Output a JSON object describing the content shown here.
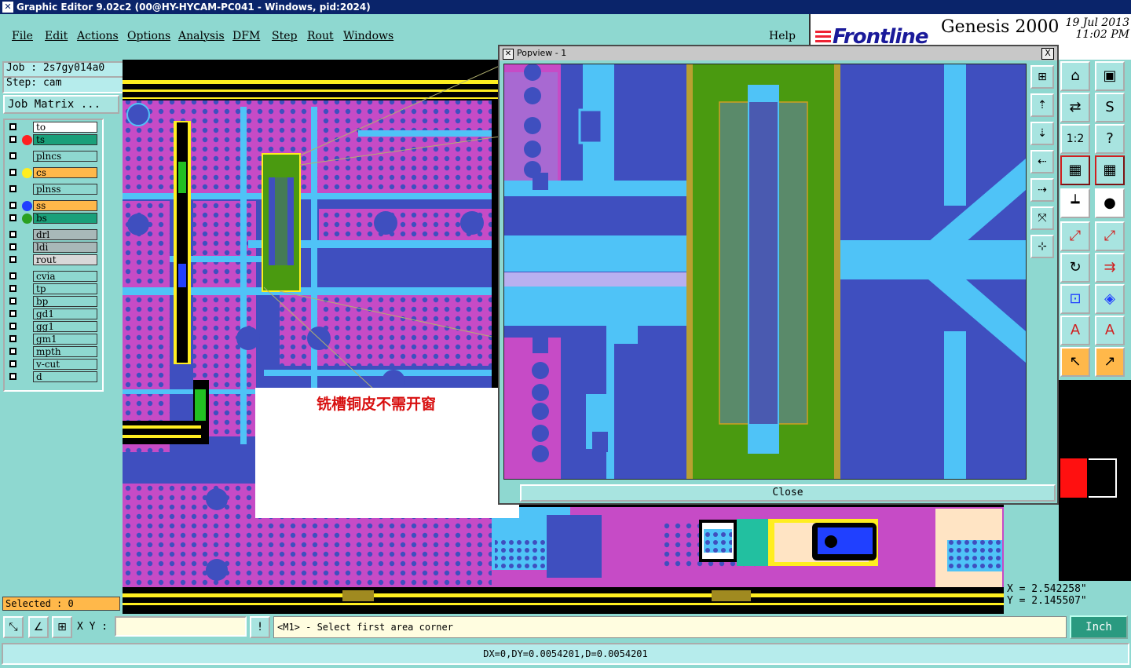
{
  "window": {
    "title": "Graphic Editor 9.02c2 (00@HY-HYCAM-PC041 - Windows, pid:2024)"
  },
  "menu": [
    "File",
    "Edit",
    "Actions",
    "Options",
    "Analysis",
    "DFM",
    "Step",
    "Rout",
    "Windows"
  ],
  "help_label": "Help",
  "brand": {
    "logo": "Frontline",
    "product": "Genesis 2000",
    "date": "19 Jul 2013",
    "time": "11:02 PM"
  },
  "job": {
    "name": "Job : 2s7gy014a0",
    "step": "Step: cam",
    "matrix_button": "Job Matrix ..."
  },
  "layers": [
    {
      "name": "to",
      "color": "#ffffff",
      "dot": ""
    },
    {
      "name": "ts",
      "color": "#1aa07a",
      "dot": "#ff2020"
    },
    {
      "name": "plncs",
      "color": "#8ed8d0",
      "dot": ""
    },
    {
      "name": "cs",
      "color": "#ffb84a",
      "dot": "#ffee20"
    },
    {
      "name": "plnss",
      "color": "#8ed8d0",
      "dot": ""
    },
    {
      "name": "ss",
      "color": "#ffb84a",
      "dot": "#2040ff"
    },
    {
      "name": "bs",
      "color": "#1aa07a",
      "dot": "#2aa020"
    },
    {
      "name": "drl",
      "color": "#a8b8b8",
      "dot": ""
    },
    {
      "name": "ldi",
      "color": "#a8b8b8",
      "dot": ""
    },
    {
      "name": "rout",
      "color": "#d8d8d8",
      "dot": ""
    },
    {
      "name": "cvia",
      "color": "#8ed8d0",
      "dot": ""
    },
    {
      "name": "tp",
      "color": "#8ed8d0",
      "dot": ""
    },
    {
      "name": "bp",
      "color": "#8ed8d0",
      "dot": ""
    },
    {
      "name": "gd1",
      "color": "#8ed8d0",
      "dot": ""
    },
    {
      "name": "gg1",
      "color": "#8ed8d0",
      "dot": ""
    },
    {
      "name": "gm1",
      "color": "#8ed8d0",
      "dot": ""
    },
    {
      "name": "mpth",
      "color": "#8ed8d0",
      "dot": ""
    },
    {
      "name": "v-cut",
      "color": "#8ed8d0",
      "dot": ""
    },
    {
      "name": "d",
      "color": "#8ed8d0",
      "dot": ""
    }
  ],
  "selected": "Selected : 0",
  "popview": {
    "title": "Popview - 1",
    "close_x": "X",
    "close_button": "Close"
  },
  "annotation": "铣槽铜皮不需开窗",
  "coords": {
    "x": "X = 2.542258\"",
    "y": "Y = 2.145507\""
  },
  "bottom": {
    "xy_label": "X Y :",
    "xy_value": "",
    "prompt": "<M1> - Select first area corner",
    "unit": "Inch",
    "status": "DX=0,DY=0.0054201,D=0.0054201"
  },
  "colors": {
    "ui_bg": "#8ed8d0",
    "cu_top": "#c64bc6",
    "cu_bottom": "#3f4fbf",
    "mask": "#4fc3f7",
    "route": "#4a9a10",
    "outline": "#ffee20"
  }
}
